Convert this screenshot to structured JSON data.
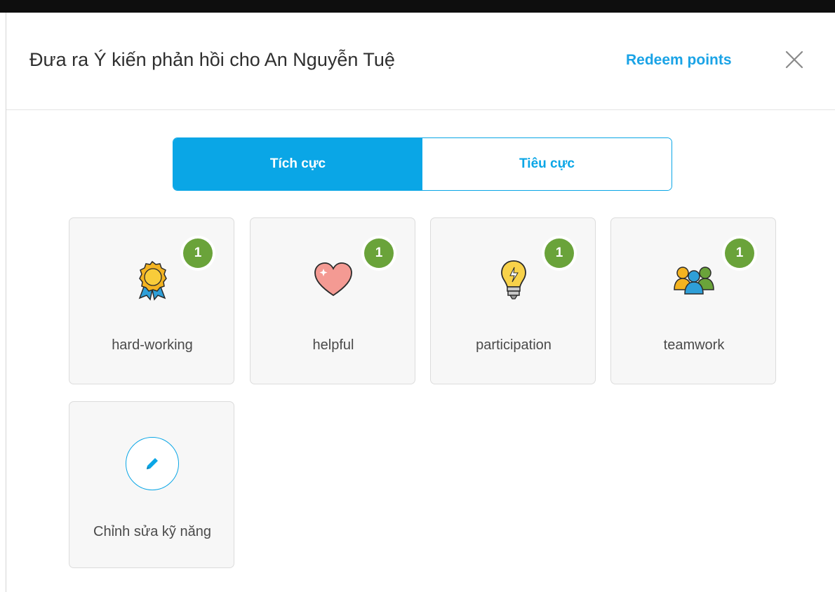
{
  "dialog": {
    "title": "Đưa ra Ý kiến phản hồi cho An Nguyễn Tuệ",
    "redeem_label": "Redeem points",
    "close_icon": "close-icon"
  },
  "tabs": [
    {
      "label": "Tích cực",
      "active": true
    },
    {
      "label": "Tiêu cực",
      "active": false
    }
  ],
  "skills": [
    {
      "label": "hard-working",
      "count": "1",
      "icon": "award-ribbon-icon"
    },
    {
      "label": "helpful",
      "count": "1",
      "icon": "heart-icon"
    },
    {
      "label": "participation",
      "count": "1",
      "icon": "lightbulb-icon"
    },
    {
      "label": "teamwork",
      "count": "1",
      "icon": "team-people-icon"
    }
  ],
  "edit_skills": {
    "label": "Chỉnh sửa kỹ năng",
    "icon": "pencil-icon"
  },
  "colors": {
    "accent": "#0aa6e6",
    "badge": "#6aa33a",
    "link": "#1aa3e6"
  }
}
